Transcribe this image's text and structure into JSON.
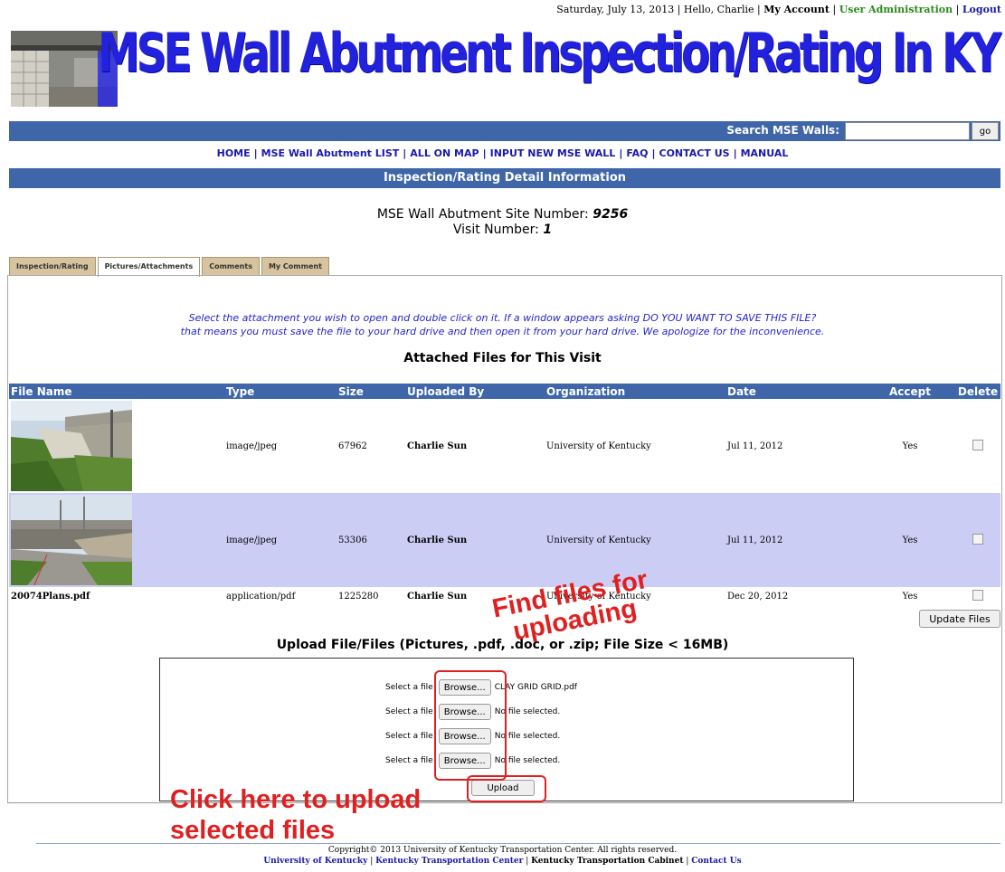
{
  "topbar": {
    "date": "Saturday, July 13, 2013",
    "greeting": "Hello, Charlie",
    "my_account": "My Account",
    "user_admin": "User Administration",
    "logout": "Logout"
  },
  "banner": {
    "title": "MSE Wall Abutment Inspection/Rating In KY"
  },
  "search": {
    "label": "Search MSE Walls:",
    "value": "",
    "go": "go"
  },
  "nav": [
    "HOME",
    "MSE Wall Abutment LIST",
    "ALL ON MAP",
    "INPUT NEW MSE WALL",
    "FAQ",
    "CONTACT US",
    "MANUAL"
  ],
  "section_header": "Inspection/Rating Detail Information",
  "site": {
    "site_label": "MSE Wall Abutment Site Number:",
    "site_number": "9256",
    "visit_label": "Visit Number:",
    "visit_number": "1"
  },
  "tabs": [
    "Inspection/Rating",
    "Pictures/Attachments",
    "Comments",
    "My Comment"
  ],
  "active_tab": "Pictures/Attachments",
  "notice": {
    "line1": "Select the attachment you wish to open and double click on it. If a window appears asking DO YOU WANT TO SAVE THIS FILE?",
    "line2": "that means you must save the file to your hard drive and then open it from your hard drive. We apologize for the inconvenience."
  },
  "attached_title": "Attached Files for This Visit",
  "files": {
    "columns": [
      "File Name",
      "Type",
      "Size",
      "Uploaded By",
      "Organization",
      "Date",
      "Accept",
      "Delete"
    ],
    "rows": [
      {
        "name": "",
        "thumbnail": "bridge-photo-1",
        "type": "image/jpeg",
        "size": "67962",
        "by": "Charlie Sun",
        "org": "University of Kentucky",
        "date": "Jul 11, 2012",
        "accept": "Yes",
        "delete": false
      },
      {
        "name": "",
        "thumbnail": "bridge-photo-2",
        "type": "image/jpeg",
        "size": "53306",
        "by": "Charlie Sun",
        "org": "University of Kentucky",
        "date": "Jul 11, 2012",
        "accept": "Yes",
        "delete": false
      },
      {
        "name": "20074Plans.pdf",
        "thumbnail": "",
        "type": "application/pdf",
        "size": "1225280",
        "by": "Charlie Sun",
        "org": "University of Kentucky",
        "date": "Dec 20, 2012",
        "accept": "Yes",
        "delete": false
      }
    ],
    "update_button": "Update Files"
  },
  "upload": {
    "title": "Upload File/Files (Pictures, .pdf, .doc, or .zip; File Size < 16MB)",
    "select_label": "Select a file",
    "browse_label": "Browse...",
    "rows": [
      "CLAY GRID GRID.pdf",
      "No file selected.",
      "No file selected.",
      "No file selected."
    ],
    "upload_button": "Upload"
  },
  "annotations": {
    "find_line1": "Find files for",
    "find_line2": "uploading",
    "click_line1": "Click here to upload",
    "click_line2": "selected files",
    "color": "#e02020"
  },
  "footer": {
    "copyright": "Copyright© 2013 University of Kentucky Transportation Center. All rights reserved.",
    "links": [
      "University of Kentucky",
      "Kentucky Transportation Center",
      "Kentucky Transportation Cabinet",
      "Contact Us"
    ]
  },
  "colors": {
    "header_blue": "#3e66a8",
    "link_blue": "#1a1aa8",
    "alt_row": "#cccdf5",
    "tab_tan": "#d7c49e",
    "notice_blue": "#2424cc"
  }
}
